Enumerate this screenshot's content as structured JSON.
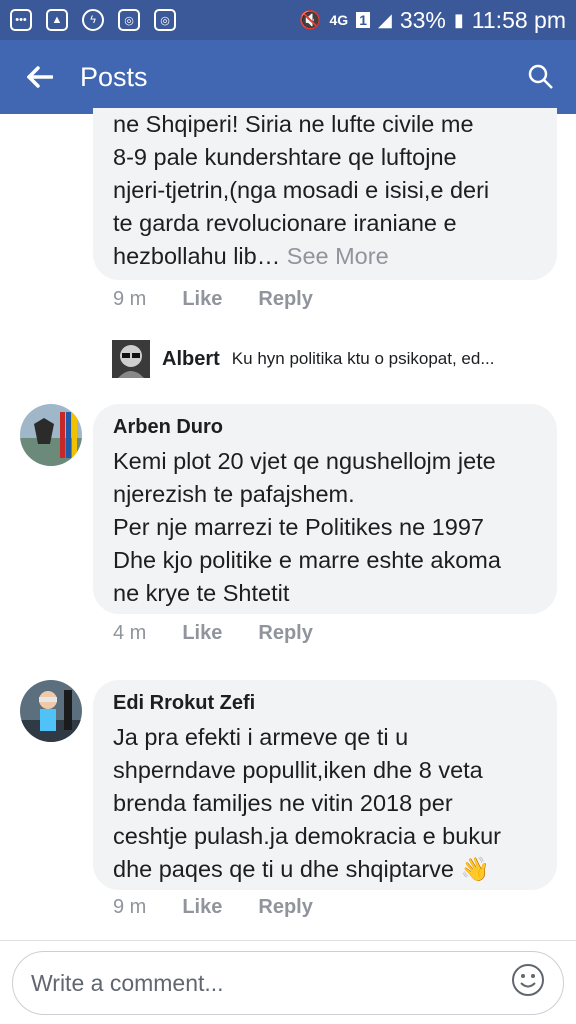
{
  "status": {
    "battery": "33%",
    "time": "11:58 pm",
    "network": "4G",
    "sim": "1"
  },
  "appbar": {
    "title": "Posts"
  },
  "comments": [
    {
      "text": "ne Shqiperi! Siria ne lufte civile me\n8-9 pale kundershtare qe luftojne\nnjeri-tjetrin,(nga mosadi e isisi,e deri\nte garda revolucionare iraniane e\nhezbollahu lib…",
      "see_more": "See More",
      "time": "9 m",
      "like": "Like",
      "reply": "Reply"
    },
    {
      "author": "Arben Duro",
      "text": "Kemi plot 20 vjet qe ngushellojm jete\nnjerezish te pafajshem.\nPer nje marrezi te Politikes ne 1997\nDhe kjo politike e marre eshte akoma\nne krye te Shtetit",
      "time": "4 m",
      "like": "Like",
      "reply": "Reply"
    },
    {
      "author": "Edi Rrokut Zefi",
      "text": "Ja pra efekti i armeve qe ti u\nshperndave popullit,iken dhe 8 veta\nbrenda familjes ne vitin 2018 per\nceshtje pulash.ja demokracia e bukur\ndhe paqes qe ti u dhe shqiptarve",
      "time": "9 m",
      "like": "Like",
      "reply": "Reply"
    }
  ],
  "reply_preview": {
    "name": "Albert",
    "text": "Ku hyn politika  ktu o psikopat, ed..."
  },
  "composer": {
    "placeholder": "Write a comment..."
  },
  "colors": {
    "header": "#4267b2",
    "statusbar": "#3b5998",
    "bubble": "#f2f3f5",
    "muted": "#90949c"
  }
}
